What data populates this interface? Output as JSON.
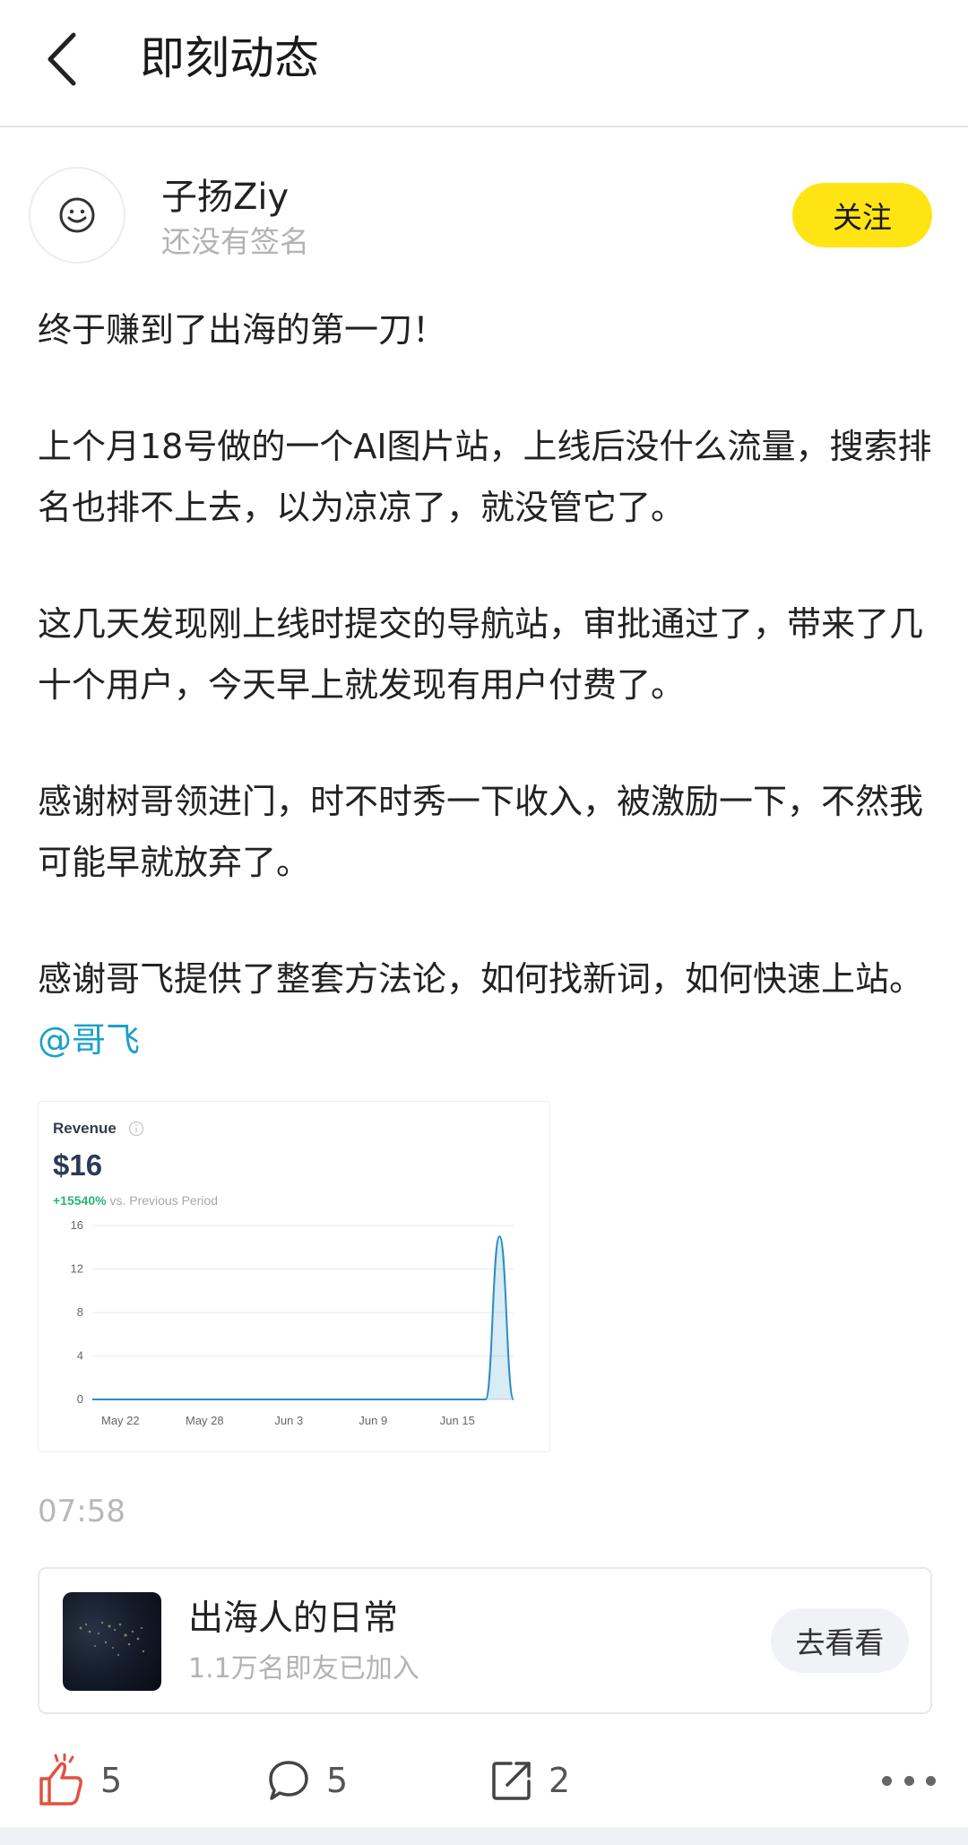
{
  "header": {
    "title": "即刻动态"
  },
  "author": {
    "name": "子扬Ziy",
    "signature": "还没有签名",
    "follow_label": "关注"
  },
  "post": {
    "paragraphs": [
      "终于赚到了出海的第一刀！",
      "上个月18号做的一个AI图片站，上线后没什么流量，搜索排名也排不上去，以为凉凉了，就没管它了。",
      "这几天发现刚上线时提交的导航站，审批通过了，带来了几十个用户，今天早上就发现有用户付费了。",
      "感谢树哥领进门，时不时秀一下收入，被激励一下，不然我可能早就放弃了。",
      "感谢哥飞提供了整套方法论，如何找新词，如何快速上站。"
    ],
    "mention": "@哥飞",
    "timestamp": "07:58"
  },
  "revenue_card": {
    "title": "Revenue",
    "amount": "$16",
    "change_pct": "+15540%",
    "change_text": "vs. Previous Period"
  },
  "chart_data": {
    "type": "area",
    "title": "Revenue",
    "x_ticks": [
      "May 22",
      "May 28",
      "Jun 3",
      "Jun 9",
      "Jun 15"
    ],
    "y_ticks": [
      0,
      4,
      8,
      12,
      16
    ],
    "ylim": [
      0,
      16
    ],
    "grid": true,
    "series": [
      {
        "x": [
          "May 20",
          "May 21",
          "May 22",
          "May 23",
          "May 24",
          "May 25",
          "May 26",
          "May 27",
          "May 28",
          "May 29",
          "May 30",
          "May 31",
          "Jun 1",
          "Jun 2",
          "Jun 3",
          "Jun 4",
          "Jun 5",
          "Jun 6",
          "Jun 7",
          "Jun 8",
          "Jun 9",
          "Jun 10",
          "Jun 11",
          "Jun 12",
          "Jun 13",
          "Jun 14",
          "Jun 15",
          "Jun 16",
          "Jun 17",
          "Jun 18",
          "Jun 19"
        ],
        "values": [
          0,
          0,
          0,
          0,
          0,
          0,
          0,
          0,
          0,
          0,
          0,
          0,
          0,
          0,
          0,
          0,
          0,
          0,
          0,
          0,
          0,
          0,
          0,
          0,
          0,
          0,
          0,
          0,
          0,
          15,
          0
        ]
      }
    ],
    "color": "#2a8ec4"
  },
  "group": {
    "name": "出海人的日常",
    "members": "1.1万名即友已加入",
    "button_label": "去看看"
  },
  "actions": {
    "likes": "5",
    "comments": "5",
    "shares": "2"
  }
}
